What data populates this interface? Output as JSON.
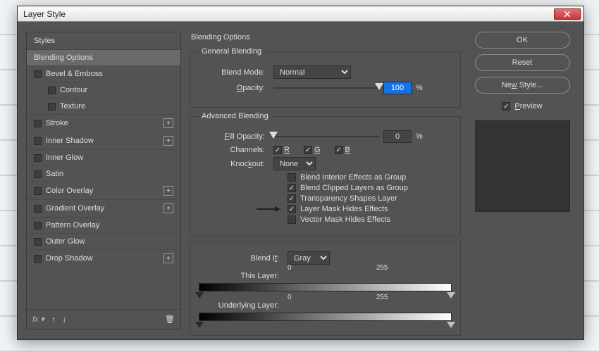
{
  "title": "Layer Style",
  "stylesHeader": "Styles",
  "styles": [
    {
      "label": "Blending Options",
      "selected": true,
      "checkbox": false,
      "plus": false
    },
    {
      "label": "Bevel & Emboss",
      "checkbox": true,
      "plus": false
    },
    {
      "label": "Contour",
      "checkbox": true,
      "plus": false,
      "sub": true
    },
    {
      "label": "Texture",
      "checkbox": true,
      "plus": false,
      "sub": true
    },
    {
      "label": "Stroke",
      "checkbox": true,
      "plus": true
    },
    {
      "label": "Inner Shadow",
      "checkbox": true,
      "plus": true
    },
    {
      "label": "Inner Glow",
      "checkbox": true,
      "plus": false
    },
    {
      "label": "Satin",
      "checkbox": true,
      "plus": false
    },
    {
      "label": "Color Overlay",
      "checkbox": true,
      "plus": true
    },
    {
      "label": "Gradient Overlay",
      "checkbox": true,
      "plus": true
    },
    {
      "label": "Pattern Overlay",
      "checkbox": true,
      "plus": false
    },
    {
      "label": "Outer Glow",
      "checkbox": true,
      "plus": false
    },
    {
      "label": "Drop Shadow",
      "checkbox": true,
      "plus": true
    }
  ],
  "center": {
    "title": "Blending Options",
    "general": {
      "legend": "General Blending",
      "blendModeLabel": "Blend Mode:",
      "blendMode": "Normal",
      "opacityLabel": "Opacity:",
      "opacity": "100",
      "percent": "%"
    },
    "advanced": {
      "legend": "Advanced Blending",
      "fillOpacityLabel": "Fill Opacity:",
      "fillOpacity": "0",
      "percent": "%",
      "channelsLabel": "Channels:",
      "ch": {
        "r": "R",
        "g": "G",
        "b": "B"
      },
      "knockoutLabel": "Knockout:",
      "knockout": "None",
      "opts": [
        {
          "label": "Blend Interior Effects as Group",
          "on": false
        },
        {
          "label": "Blend Clipped Layers as Group",
          "on": true
        },
        {
          "label": "Transparency Shapes Layer",
          "on": true
        },
        {
          "label": "Layer Mask Hides Effects",
          "on": true,
          "arrow": true
        },
        {
          "label": "Vector Mask Hides Effects",
          "on": false
        }
      ]
    },
    "blendif": {
      "label": "Blend If:",
      "value": "Gray",
      "thisLayer": "This Layer:",
      "underlying": "Underlying Layer:",
      "lo": "0",
      "hi": "255"
    }
  },
  "buttons": {
    "ok": "OK",
    "reset": "Reset",
    "newStyle": "New Style...",
    "preview": "Preview"
  }
}
